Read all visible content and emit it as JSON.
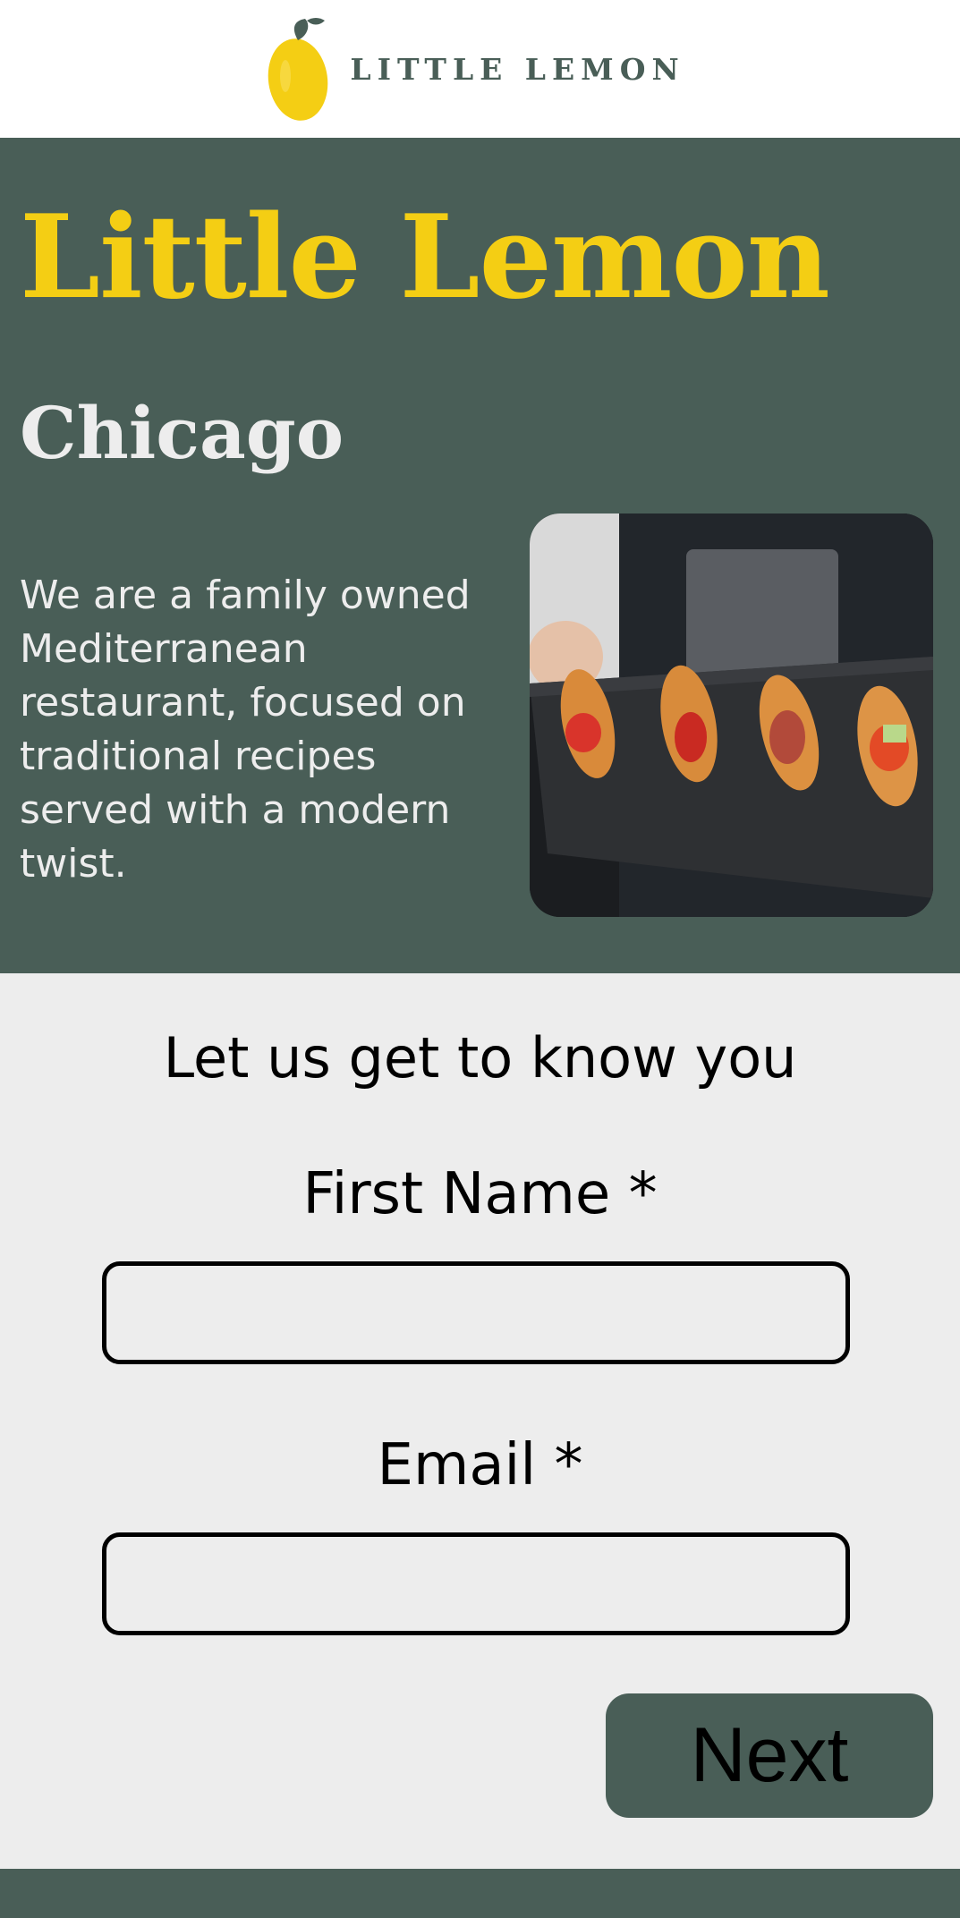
{
  "header": {
    "logo_text": "LITTLE LEMON"
  },
  "hero": {
    "title": "Little Lemon",
    "subtitle": "Chicago",
    "description": "We are a family owned Mediterranean restaurant, focused on traditional recipes served with a modern twist."
  },
  "form": {
    "heading": "Let us get to know you",
    "first_name_label": "First Name *",
    "first_name_value": "",
    "email_label": "Email *",
    "email_value": "",
    "next_label": "Next"
  },
  "colors": {
    "primary_green": "#495e57",
    "primary_yellow": "#f4ce14",
    "highlight_light": "#ededed"
  }
}
